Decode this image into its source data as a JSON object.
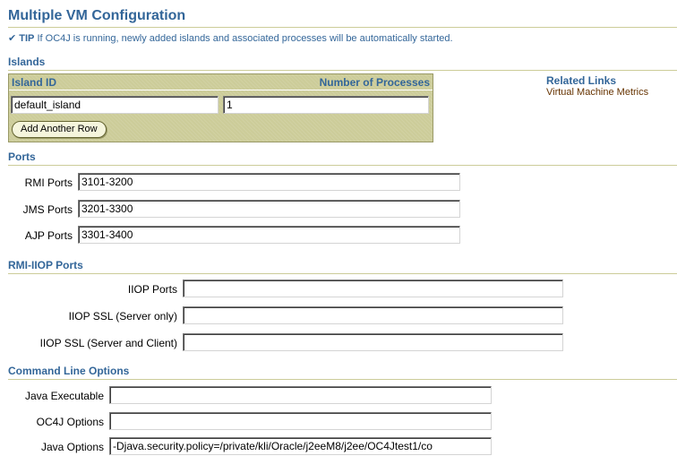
{
  "page": {
    "title": "Multiple VM Configuration",
    "tip_icon": "✔",
    "tip_label": "TIP",
    "tip_text": "If OC4J is running, newly added islands and associated processes will be automatically started."
  },
  "islands": {
    "section_title": "Islands",
    "columns": [
      "Island ID",
      "Number of Processes"
    ],
    "rows": [
      {
        "island_id": "default_island",
        "num_processes": "1"
      }
    ],
    "add_row_label": "Add Another Row"
  },
  "related_links": {
    "title": "Related Links",
    "links": [
      "Virtual Machine Metrics"
    ]
  },
  "ports": {
    "section_title": "Ports",
    "fields": [
      {
        "label": "RMI Ports",
        "value": "3101-3200"
      },
      {
        "label": "JMS Ports",
        "value": "3201-3300"
      },
      {
        "label": "AJP Ports",
        "value": "3301-3400"
      }
    ]
  },
  "rmi_iiop": {
    "section_title": "RMI-IIOP Ports",
    "fields": [
      {
        "label": "IIOP Ports",
        "value": ""
      },
      {
        "label": "IIOP SSL (Server only)",
        "value": ""
      },
      {
        "label": "IIOP SSL (Server and Client)",
        "value": ""
      }
    ]
  },
  "command_line": {
    "section_title": "Command Line Options",
    "fields": [
      {
        "label": "Java Executable",
        "value": ""
      },
      {
        "label": "OC4J Options",
        "value": ""
      },
      {
        "label": "Java Options",
        "value": "-Djava.security.policy=/private/kli/Oracle/j2eeM8/j2ee/OC4Jtest1/co"
      }
    ]
  },
  "colors": {
    "header_blue": "#336699",
    "table_bg": "#cccc99",
    "link_brown": "#663300"
  }
}
